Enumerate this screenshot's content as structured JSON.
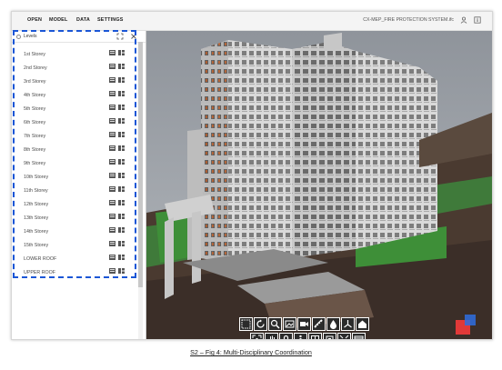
{
  "menu": {
    "open": "OPEN",
    "model": "MODEL",
    "data": "DATA",
    "settings": "SETTINGS"
  },
  "file_name": "CX-MEP_FIRE PROTECTION SYSTEM.ifc",
  "icons": {
    "user": "user-icon",
    "info": "info-icon",
    "expand": "expand-icon",
    "close": "close-icon"
  },
  "levels_panel": {
    "title": "Levels",
    "items": [
      {
        "label": "1st Storey"
      },
      {
        "label": "2nd Storey"
      },
      {
        "label": "3rd Storey"
      },
      {
        "label": "4th Storey"
      },
      {
        "label": "5th Storey"
      },
      {
        "label": "6th Storey"
      },
      {
        "label": "7th Storey"
      },
      {
        "label": "8th Storey"
      },
      {
        "label": "9th Storey"
      },
      {
        "label": "10th Storey"
      },
      {
        "label": "11th Storey"
      },
      {
        "label": "12th Storey"
      },
      {
        "label": "13th Storey"
      },
      {
        "label": "14th Storey"
      },
      {
        "label": "15th Storey"
      },
      {
        "label": "LOWER ROOF"
      },
      {
        "label": "UPPER ROOF"
      }
    ]
  },
  "toolbar": {
    "row1": [
      "select-box-icon",
      "rotate-icon",
      "zoom-icon",
      "image-icon",
      "camera-icon",
      "measure-icon",
      "transparency-icon",
      "axes-icon",
      "home-icon"
    ],
    "row2": [
      "fit-icon",
      "pan-icon",
      "lock-icon",
      "walk-icon",
      "section-icon",
      "clip-icon",
      "explode-icon",
      "window-icon"
    ]
  },
  "colors": {
    "highlight": "#1a56d6",
    "toolbar": "#2b2b2b",
    "sky": "#9ea3aa"
  },
  "caption": "S2 – Fig 4: Multi-Disciplinary Coordination"
}
